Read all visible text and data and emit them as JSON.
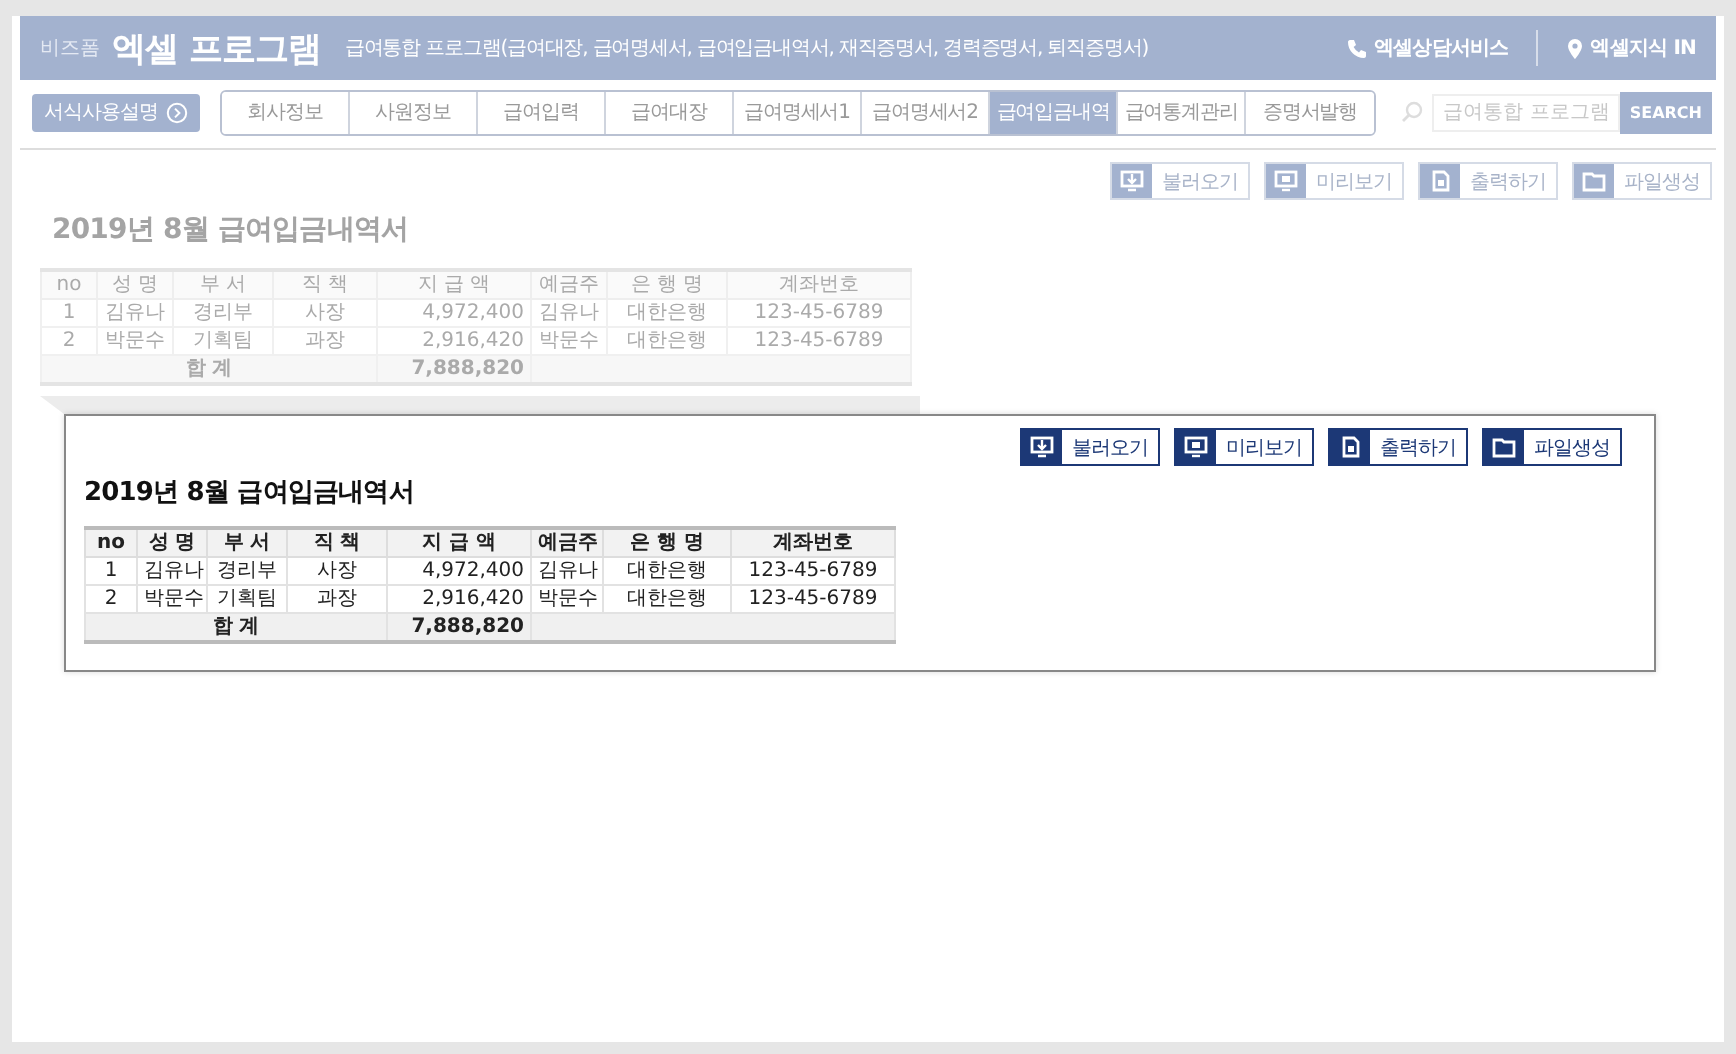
{
  "header": {
    "brand_small": "비즈폼",
    "brand": "엑셀 프로그램",
    "subtitle": "급여통합 프로그램(급여대장, 급여명세서, 급여입금내역서, 재직증명서, 경력증명서, 퇴직증명서)",
    "links": [
      {
        "kind": "phone",
        "label": "엑셀상담서비스"
      },
      {
        "kind": "pin",
        "label": "엑셀지식 IN"
      }
    ]
  },
  "nav": {
    "guide_button": "서식사용설명",
    "tabs": [
      {
        "label": "회사정보",
        "selected": false
      },
      {
        "label": "사원정보",
        "selected": false
      },
      {
        "label": "급여입력",
        "selected": false
      },
      {
        "label": "급여대장",
        "selected": false
      },
      {
        "label": "급여명세서1",
        "selected": false
      },
      {
        "label": "급여명세서2",
        "selected": false
      },
      {
        "label": "급여입금내역",
        "selected": true
      },
      {
        "label": "급여통계관리",
        "selected": false
      },
      {
        "label": "증명서발행",
        "selected": false
      }
    ],
    "search": {
      "placeholder": "급여통합 프로그램",
      "button": "SEARCH"
    }
  },
  "sheet": {
    "toolbar": [
      {
        "kind": "load",
        "label": "불러오기"
      },
      {
        "kind": "preview",
        "label": "미리보기"
      },
      {
        "kind": "print",
        "label": "출력하기"
      },
      {
        "kind": "file",
        "label": "파일생성"
      }
    ],
    "title": "2019년 8월 급여입금내역서",
    "table": {
      "columns": [
        {
          "label": "no"
        },
        {
          "label": "성 명"
        },
        {
          "label": "부 서"
        },
        {
          "label": "직 책"
        },
        {
          "label": "지 급 액",
          "numeric": true
        },
        {
          "label": "예금주"
        },
        {
          "label": "은 행 명"
        },
        {
          "label": "계좌번호"
        }
      ],
      "rows": [
        [
          "1",
          "김유나",
          "경리부",
          "사장",
          "4,972,400",
          "김유나",
          "대한은행",
          "123-45-6789"
        ],
        [
          "2",
          "박문수",
          "기획팀",
          "과장",
          "2,916,420",
          "박문수",
          "대한은행",
          "123-45-6789"
        ]
      ],
      "total": {
        "label": "합 계",
        "amount": "7,888,820"
      }
    }
  },
  "zoom_callout": {
    "toolbar": [
      {
        "kind": "load",
        "label": "불러오기"
      },
      {
        "kind": "preview",
        "label": "미리보기"
      },
      {
        "kind": "print",
        "label": "출력하기"
      },
      {
        "kind": "file",
        "label": "파일생성"
      }
    ],
    "title": "2019년 8월 급여입금내역서",
    "table": {
      "columns": [
        {
          "label": "no"
        },
        {
          "label": "성 명"
        },
        {
          "label": "부 서"
        },
        {
          "label": "직 책"
        },
        {
          "label": "지 급 액",
          "numeric": true
        },
        {
          "label": "예금주"
        },
        {
          "label": "은 행 명"
        },
        {
          "label": "계좌번호"
        }
      ],
      "rows": [
        [
          "1",
          "김유나",
          "경리부",
          "사장",
          "4,972,400",
          "김유나",
          "대한은행",
          "123-45-6789"
        ],
        [
          "2",
          "박문수",
          "기획팀",
          "과장",
          "2,916,420",
          "박문수",
          "대한은행",
          "123-45-6789"
        ]
      ],
      "total": {
        "label": "합 계",
        "amount": "7,888,820"
      }
    }
  }
}
